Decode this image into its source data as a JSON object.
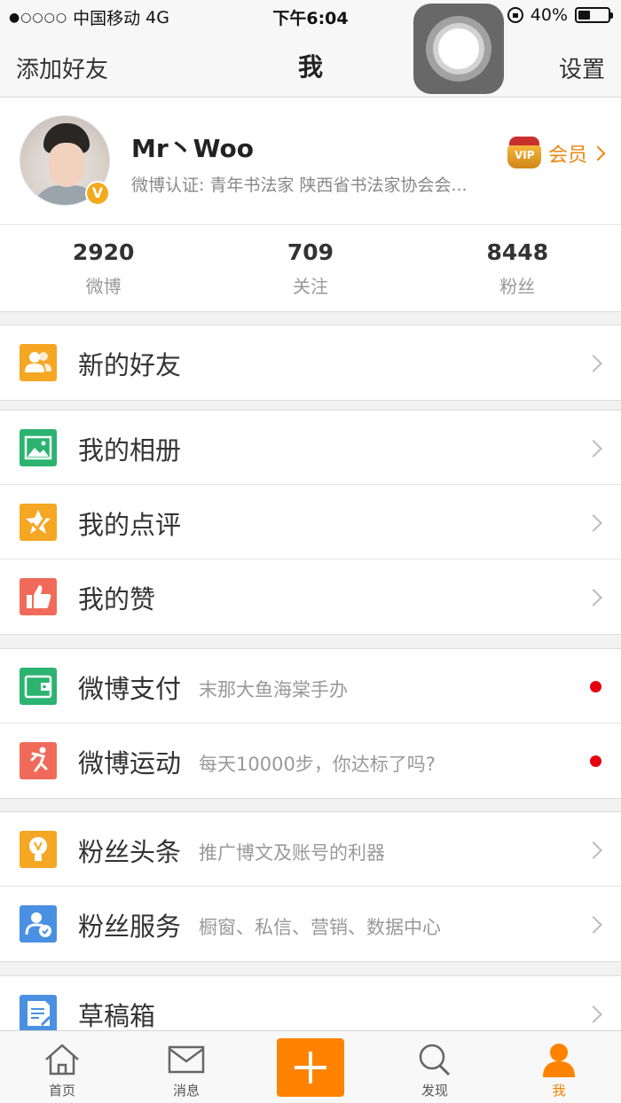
{
  "status_bar": {
    "signal": "●○○○○",
    "carrier": "中国移动",
    "network": "4G",
    "time": "下午6:04",
    "battery_pct": "40%",
    "battery_level": 0.4
  },
  "nav": {
    "left": "添加好友",
    "title": "我",
    "right": "设置"
  },
  "profile": {
    "name": "Mr丶Woo",
    "description": "微博认证: 青年书法家 陕西省书法家协会会...",
    "verified_badge": "V",
    "vip_label": "会员",
    "vip_crown_mark": "VIP"
  },
  "stats": [
    {
      "num": "2920",
      "label": "微博"
    },
    {
      "num": "709",
      "label": "关注"
    },
    {
      "num": "8448",
      "label": "粉丝"
    }
  ],
  "groups": [
    {
      "items": [
        {
          "label": "新的好友",
          "sub": "",
          "icon": "friends-icon",
          "color": "#f5a623",
          "trail": "arrow"
        }
      ]
    },
    {
      "items": [
        {
          "label": "我的相册",
          "sub": "",
          "icon": "album-icon",
          "color": "#2bb36f",
          "trail": "arrow"
        },
        {
          "label": "我的点评",
          "sub": "",
          "icon": "review-star-icon",
          "color": "#f5a623",
          "trail": "arrow"
        },
        {
          "label": "我的赞",
          "sub": "",
          "icon": "thumbs-up-icon",
          "color": "#f06a5a",
          "trail": "arrow"
        }
      ]
    },
    {
      "items": [
        {
          "label": "微博支付",
          "sub": "末那大鱼海棠手办",
          "icon": "wallet-icon",
          "color": "#2bb36f",
          "trail": "dot"
        },
        {
          "label": "微博运动",
          "sub": "每天10000步，你达标了吗?",
          "icon": "running-icon",
          "color": "#f06a5a",
          "trail": "dot"
        }
      ]
    },
    {
      "items": [
        {
          "label": "粉丝头条",
          "sub": "推广博文及账号的利器",
          "icon": "lightbulb-icon",
          "color": "#f5a623",
          "trail": "arrow"
        },
        {
          "label": "粉丝服务",
          "sub": "橱窗、私信、营销、数据中心",
          "icon": "fan-service-icon",
          "color": "#4a90e2",
          "trail": "arrow"
        }
      ]
    },
    {
      "items": [
        {
          "label": "草稿箱",
          "sub": "",
          "icon": "drafts-icon",
          "color": "#4a90e2",
          "trail": "arrow"
        }
      ]
    }
  ],
  "tabbar": [
    {
      "label": "首页",
      "icon": "home-icon"
    },
    {
      "label": "消息",
      "icon": "message-icon"
    },
    {
      "label": "",
      "icon": "plus-icon"
    },
    {
      "label": "发现",
      "icon": "search-icon"
    },
    {
      "label": "我",
      "icon": "profile-icon",
      "active": true
    }
  ],
  "colors": {
    "accent": "#ff8200",
    "badge_dot": "#e60012"
  }
}
